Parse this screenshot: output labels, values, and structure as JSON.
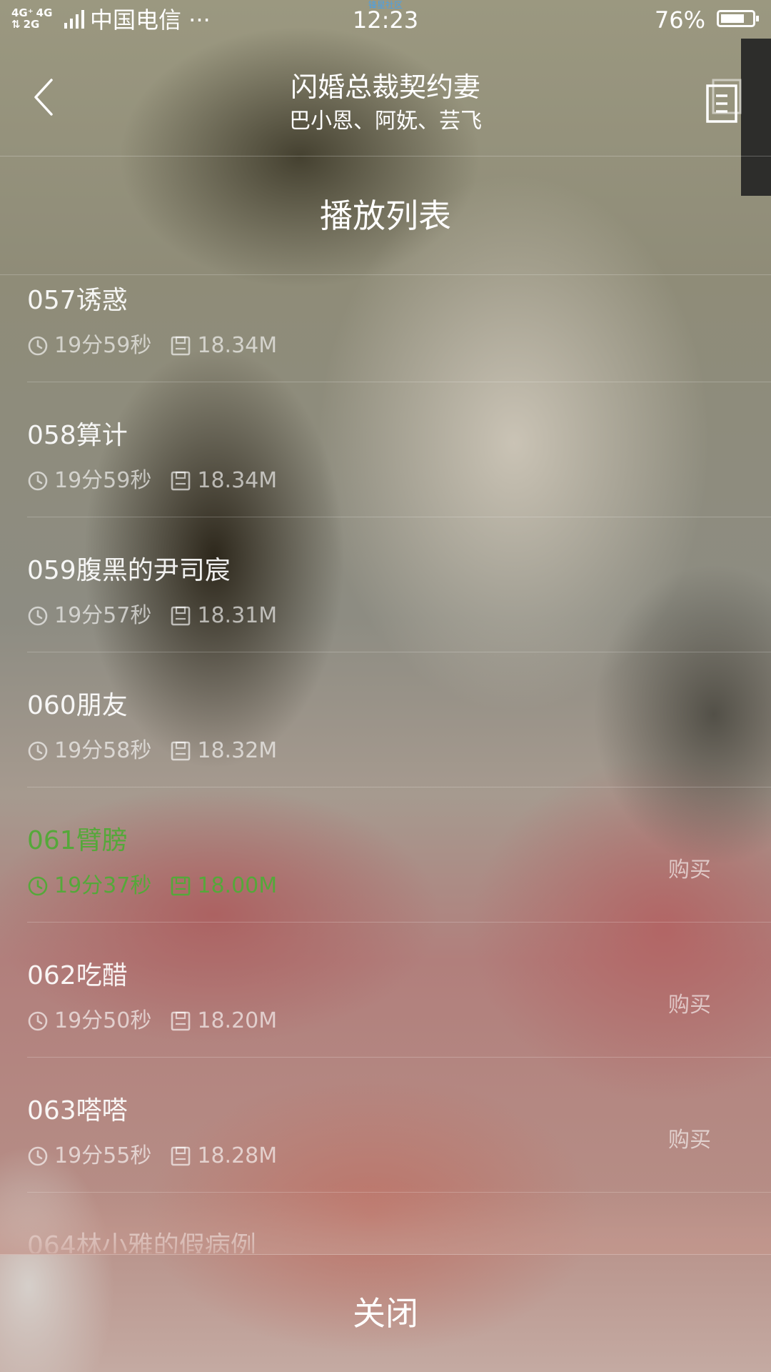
{
  "status_bar": {
    "network_top": [
      "4G⁺",
      "4G"
    ],
    "network_bottom": [
      "⇅",
      "2G"
    ],
    "carrier": "中国电信 ···",
    "time": "12:23",
    "watermark": "锋星社区",
    "battery_percent": "76%",
    "battery_level": 0.76
  },
  "header": {
    "title": "闪婚总裁契约妻",
    "subtitle": "巴小恩、阿妩、芸飞",
    "back_icon": "chevron-left-icon",
    "list_icon": "document-list-icon"
  },
  "panel": {
    "title": "播放列表",
    "close_label": "关闭",
    "accent_color": "#55a83a"
  },
  "episodes": [
    {
      "title": "057诱惑",
      "duration": "19分59秒",
      "size": "18.34M",
      "buy": "",
      "playing": false
    },
    {
      "title": "058算计",
      "duration": "19分59秒",
      "size": "18.34M",
      "buy": "",
      "playing": false
    },
    {
      "title": "059腹黑的尹司宸",
      "duration": "19分57秒",
      "size": "18.31M",
      "buy": "",
      "playing": false
    },
    {
      "title": "060朋友",
      "duration": "19分58秒",
      "size": "18.32M",
      "buy": "",
      "playing": false
    },
    {
      "title": "061臂膀",
      "duration": "19分37秒",
      "size": "18.00M",
      "buy": "购买",
      "playing": true
    },
    {
      "title": "062吃醋",
      "duration": "19分50秒",
      "size": "18.20M",
      "buy": "购买",
      "playing": false
    },
    {
      "title": "063嗒嗒",
      "duration": "19分55秒",
      "size": "18.28M",
      "buy": "购买",
      "playing": false
    },
    {
      "title": "064林小雅的假病例",
      "duration": "",
      "size": "",
      "buy": "",
      "playing": false
    }
  ]
}
